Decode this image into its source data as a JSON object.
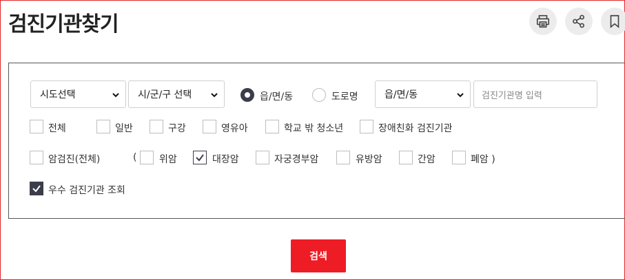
{
  "page": {
    "title": "검진기관찾기"
  },
  "toolbar": {
    "print_icon": "printer-icon",
    "share_icon": "share-icon",
    "bookmark_icon": "bookmark-icon"
  },
  "filters": {
    "sido_select": "시도선택",
    "sigungu_select": "시/군/구 선택",
    "address_type": {
      "option_1": "읍/면/동",
      "option_2": "도로명",
      "selected": "읍/면/동"
    },
    "eupmyeondong_select": "읍/면/동",
    "name_input_placeholder": "검진기관명 입력"
  },
  "exam_types": [
    {
      "label": "전체",
      "checked": false
    },
    {
      "label": "일반",
      "checked": false
    },
    {
      "label": "구강",
      "checked": false
    },
    {
      "label": "영유아",
      "checked": false
    },
    {
      "label": "학교 밖 청소년",
      "checked": false
    },
    {
      "label": "장애친화 검진기관",
      "checked": false
    }
  ],
  "cancer": {
    "all_label": "암검진(전체)",
    "open_paren": "(",
    "items": [
      {
        "label": "위암",
        "checked": false
      },
      {
        "label": "대장암",
        "checked": true
      },
      {
        "label": "자궁경부암",
        "checked": false
      },
      {
        "label": "유방암",
        "checked": false
      },
      {
        "label": "간암",
        "checked": false
      },
      {
        "label": "폐암 )",
        "checked": false
      }
    ]
  },
  "excellent": {
    "label": "우수 검진기관 조회",
    "checked": true
  },
  "actions": {
    "search_label": "검색"
  },
  "colors": {
    "accent": "#ee1c25",
    "checked": "#3b3d4a"
  }
}
